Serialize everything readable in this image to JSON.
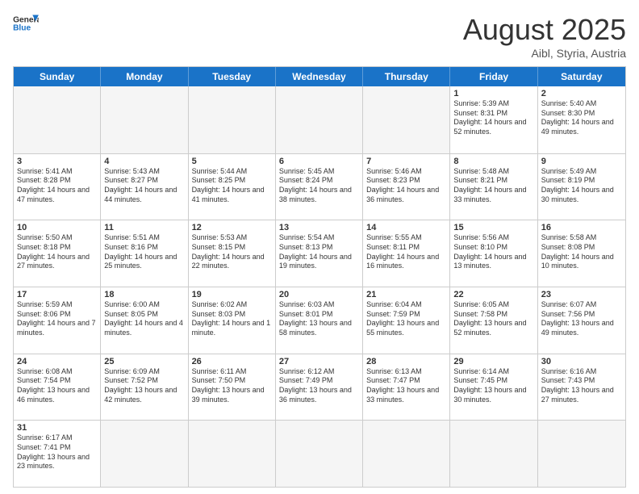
{
  "header": {
    "logo_general": "General",
    "logo_blue": "Blue",
    "month_title": "August 2025",
    "location": "Aibl, Styria, Austria"
  },
  "days_of_week": [
    "Sunday",
    "Monday",
    "Tuesday",
    "Wednesday",
    "Thursday",
    "Friday",
    "Saturday"
  ],
  "weeks": [
    [
      {
        "day": "",
        "empty": true
      },
      {
        "day": "",
        "empty": true
      },
      {
        "day": "",
        "empty": true
      },
      {
        "day": "",
        "empty": true
      },
      {
        "day": "",
        "empty": true
      },
      {
        "day": "1",
        "sunrise": "5:39 AM",
        "sunset": "8:31 PM",
        "daylight": "14 hours and 52 minutes."
      },
      {
        "day": "2",
        "sunrise": "5:40 AM",
        "sunset": "8:30 PM",
        "daylight": "14 hours and 49 minutes."
      }
    ],
    [
      {
        "day": "3",
        "sunrise": "5:41 AM",
        "sunset": "8:28 PM",
        "daylight": "14 hours and 47 minutes."
      },
      {
        "day": "4",
        "sunrise": "5:43 AM",
        "sunset": "8:27 PM",
        "daylight": "14 hours and 44 minutes."
      },
      {
        "day": "5",
        "sunrise": "5:44 AM",
        "sunset": "8:25 PM",
        "daylight": "14 hours and 41 minutes."
      },
      {
        "day": "6",
        "sunrise": "5:45 AM",
        "sunset": "8:24 PM",
        "daylight": "14 hours and 38 minutes."
      },
      {
        "day": "7",
        "sunrise": "5:46 AM",
        "sunset": "8:23 PM",
        "daylight": "14 hours and 36 minutes."
      },
      {
        "day": "8",
        "sunrise": "5:48 AM",
        "sunset": "8:21 PM",
        "daylight": "14 hours and 33 minutes."
      },
      {
        "day": "9",
        "sunrise": "5:49 AM",
        "sunset": "8:19 PM",
        "daylight": "14 hours and 30 minutes."
      }
    ],
    [
      {
        "day": "10",
        "sunrise": "5:50 AM",
        "sunset": "8:18 PM",
        "daylight": "14 hours and 27 minutes."
      },
      {
        "day": "11",
        "sunrise": "5:51 AM",
        "sunset": "8:16 PM",
        "daylight": "14 hours and 25 minutes."
      },
      {
        "day": "12",
        "sunrise": "5:53 AM",
        "sunset": "8:15 PM",
        "daylight": "14 hours and 22 minutes."
      },
      {
        "day": "13",
        "sunrise": "5:54 AM",
        "sunset": "8:13 PM",
        "daylight": "14 hours and 19 minutes."
      },
      {
        "day": "14",
        "sunrise": "5:55 AM",
        "sunset": "8:11 PM",
        "daylight": "14 hours and 16 minutes."
      },
      {
        "day": "15",
        "sunrise": "5:56 AM",
        "sunset": "8:10 PM",
        "daylight": "14 hours and 13 minutes."
      },
      {
        "day": "16",
        "sunrise": "5:58 AM",
        "sunset": "8:08 PM",
        "daylight": "14 hours and 10 minutes."
      }
    ],
    [
      {
        "day": "17",
        "sunrise": "5:59 AM",
        "sunset": "8:06 PM",
        "daylight": "14 hours and 7 minutes."
      },
      {
        "day": "18",
        "sunrise": "6:00 AM",
        "sunset": "8:05 PM",
        "daylight": "14 hours and 4 minutes."
      },
      {
        "day": "19",
        "sunrise": "6:02 AM",
        "sunset": "8:03 PM",
        "daylight": "14 hours and 1 minute."
      },
      {
        "day": "20",
        "sunrise": "6:03 AM",
        "sunset": "8:01 PM",
        "daylight": "13 hours and 58 minutes."
      },
      {
        "day": "21",
        "sunrise": "6:04 AM",
        "sunset": "7:59 PM",
        "daylight": "13 hours and 55 minutes."
      },
      {
        "day": "22",
        "sunrise": "6:05 AM",
        "sunset": "7:58 PM",
        "daylight": "13 hours and 52 minutes."
      },
      {
        "day": "23",
        "sunrise": "6:07 AM",
        "sunset": "7:56 PM",
        "daylight": "13 hours and 49 minutes."
      }
    ],
    [
      {
        "day": "24",
        "sunrise": "6:08 AM",
        "sunset": "7:54 PM",
        "daylight": "13 hours and 46 minutes."
      },
      {
        "day": "25",
        "sunrise": "6:09 AM",
        "sunset": "7:52 PM",
        "daylight": "13 hours and 42 minutes."
      },
      {
        "day": "26",
        "sunrise": "6:11 AM",
        "sunset": "7:50 PM",
        "daylight": "13 hours and 39 minutes."
      },
      {
        "day": "27",
        "sunrise": "6:12 AM",
        "sunset": "7:49 PM",
        "daylight": "13 hours and 36 minutes."
      },
      {
        "day": "28",
        "sunrise": "6:13 AM",
        "sunset": "7:47 PM",
        "daylight": "13 hours and 33 minutes."
      },
      {
        "day": "29",
        "sunrise": "6:14 AM",
        "sunset": "7:45 PM",
        "daylight": "13 hours and 30 minutes."
      },
      {
        "day": "30",
        "sunrise": "6:16 AM",
        "sunset": "7:43 PM",
        "daylight": "13 hours and 27 minutes."
      }
    ],
    [
      {
        "day": "31",
        "sunrise": "6:17 AM",
        "sunset": "7:41 PM",
        "daylight": "13 hours and 23 minutes."
      },
      {
        "day": "",
        "empty": true
      },
      {
        "day": "",
        "empty": true
      },
      {
        "day": "",
        "empty": true
      },
      {
        "day": "",
        "empty": true
      },
      {
        "day": "",
        "empty": true
      },
      {
        "day": "",
        "empty": true
      }
    ]
  ]
}
